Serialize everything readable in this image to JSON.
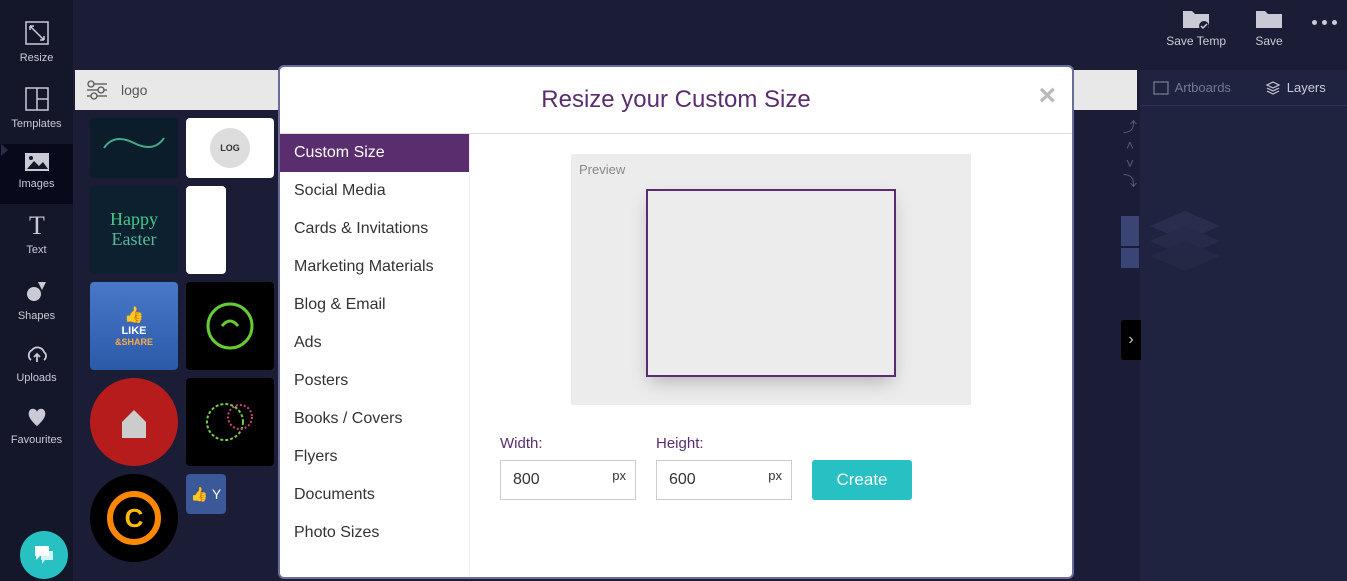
{
  "left_sidebar": {
    "items": [
      {
        "label": "Resize"
      },
      {
        "label": "Templates"
      },
      {
        "label": "Images"
      },
      {
        "label": "Text"
      },
      {
        "label": "Shapes"
      },
      {
        "label": "Uploads"
      },
      {
        "label": "Favourites"
      }
    ]
  },
  "top_right": {
    "save_temp": "Save Temp",
    "save": "Save"
  },
  "search": {
    "value": "logo"
  },
  "right_panel": {
    "artboards": "Artboards",
    "layers": "Layers"
  },
  "modal": {
    "title": "Resize your Custom Size",
    "categories": [
      "Custom Size",
      "Social Media",
      "Cards & Invitations",
      "Marketing Materials",
      "Blog & Email",
      "Ads",
      "Posters",
      "Books / Covers",
      "Flyers",
      "Documents",
      "Photo Sizes"
    ],
    "preview_label": "Preview",
    "width_label": "Width:",
    "height_label": "Height:",
    "width_value": "800",
    "height_value": "600",
    "unit": "px",
    "create_label": "Create"
  }
}
